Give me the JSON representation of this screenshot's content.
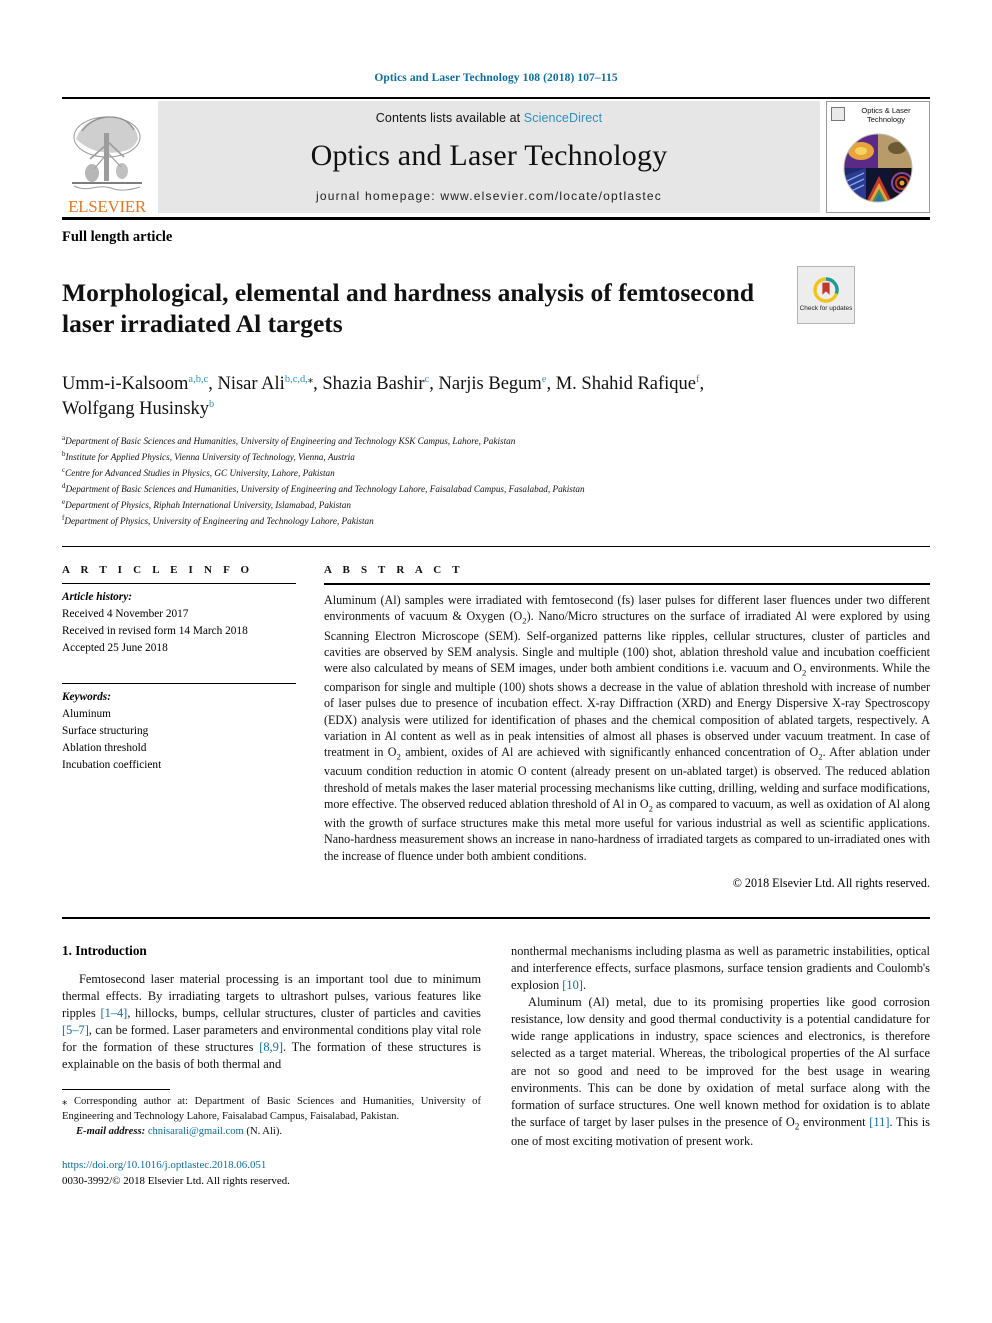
{
  "running_head": "Optics and Laser Technology 108 (2018) 107–115",
  "masthead": {
    "contents_prefix": "Contents lists available at ",
    "sciencedirect": "ScienceDirect",
    "journal_name": "Optics and Laser Technology",
    "homepage": "journal homepage: www.elsevier.com/locate/optlastec",
    "publisher": "ELSEVIER",
    "cover_title": "Optics & Laser Technology"
  },
  "article": {
    "type": "Full length article",
    "title": "Morphological, elemental and hardness analysis of femtosecond laser irradiated Al targets",
    "crossmark_label": "Check for updates"
  },
  "authors": {
    "line1_parts": [
      {
        "name": "Umm-i-Kalsoom",
        "sup": "a,b,c"
      },
      {
        "name": "Nisar Ali",
        "sup": "b,c,d,"
      },
      {
        "name": "Shazia Bashir",
        "sup": "c"
      },
      {
        "name": "Narjis Begum",
        "sup": "e"
      },
      {
        "name": "M. Shahid Rafique",
        "sup": "f"
      },
      {
        "name": "Wolfgang Husinsky",
        "sup": "b"
      }
    ]
  },
  "affiliations": [
    {
      "mark": "a",
      "text": "Department of Basic Sciences and Humanities, University of Engineering and Technology KSK Campus, Lahore, Pakistan"
    },
    {
      "mark": "b",
      "text": "Institute for Applied Physics, Vienna University of Technology, Vienna, Austria"
    },
    {
      "mark": "c",
      "text": "Centre for Advanced Studies in Physics, GC University, Lahore, Pakistan"
    },
    {
      "mark": "d",
      "text": "Department of Basic Sciences and Humanities, University of Engineering and Technology Lahore, Faisalabad Campus, Fasalabad, Pakistan"
    },
    {
      "mark": "e",
      "text": "Department of Physics, Riphah International University, Islamabad, Pakistan"
    },
    {
      "mark": "f",
      "text": "Department of Physics, University of Engineering and Technology Lahore, Pakistan"
    }
  ],
  "article_info": {
    "heading": "A R T I C L E   I N F O",
    "history_label": "Article history:",
    "history": [
      "Received 4 November 2017",
      "Received in revised form 14 March 2018",
      "Accepted 25 June 2018"
    ],
    "keywords_label": "Keywords:",
    "keywords": [
      "Aluminum",
      "Surface structuring",
      "Ablation threshold",
      "Incubation coefficient"
    ]
  },
  "abstract": {
    "heading": "A B S T R A C T",
    "paragraph_html": "Aluminum (Al) samples were irradiated with femtosecond (fs) laser pulses for different laser fluences under two different environments of vacuum &amp; Oxygen (O<sub>2</sub>). Nano/Micro structures on the surface of irradiated Al were explored by using Scanning Electron Microscope (SEM). Self-organized patterns like ripples, cellular structures, cluster of particles and cavities are observed by SEM analysis. Single and multiple (100) shot, ablation threshold value and incubation coefficient were also calculated by means of SEM images, under both ambient conditions i.e. vacuum and O<sub>2</sub> environments. While the comparison for single and multiple (100) shots shows a decrease in the value of ablation threshold with increase of number of laser pulses due to presence of incubation effect. X-ray Diffraction (XRD) and Energy Dispersive X-ray Spectroscopy (EDX) analysis were utilized for identification of phases and the chemical composition of ablated targets, respectively. A variation in Al content as well as in peak intensities of almost all phases is observed under vacuum treatment. In case of treatment in O<sub>2</sub> ambient, oxides of Al are achieved with significantly enhanced concentration of O<sub>2</sub>. After ablation under vacuum condition reduction in atomic O content (already present on un-ablated target) is observed. The reduced ablation threshold of metals makes the laser material processing mechanisms like cutting, drilling, welding and surface modifications, more effective. The observed reduced ablation threshold of Al in O<sub>2</sub> as compared to vacuum, as well as oxidation of Al along with the growth of surface structures make this metal more useful for various industrial as well as scientific applications. Nano-hardness measurement shows an increase in nano-hardness of irradiated targets as compared to un-irradiated ones with the increase of fluence under both ambient conditions.",
    "copyright": "© 2018 Elsevier Ltd. All rights reserved."
  },
  "body": {
    "section_heading": "1. Introduction",
    "left_paragraph_html": "Femtosecond laser material processing is an important tool due to minimum thermal effects. By irradiating targets to ultrashort pulses, various features like ripples <span class=\"ref\">[1–4]</span>, hillocks, bumps, cellular structures, cluster of particles and cavities <span class=\"ref\">[5–7]</span>, can be formed. Laser parameters and environmental conditions play vital role for the formation of these structures <span class=\"ref\">[8,9]</span>. The formation of these structures is explainable on the basis of both thermal and",
    "right_paragraph1_html": "nonthermal mechanisms including plasma as well as parametric instabilities, optical and interference effects, surface plasmons, surface tension gradients and Coulomb's explosion <span class=\"ref\">[10]</span>.",
    "right_paragraph2_html": "Aluminum (Al) metal, due to its promising properties like good corrosion resistance, low density and good thermal conductivity is a potential candidature for wide range applications in industry, space sciences and electronics, is therefore selected as a target material. Whereas, the tribological properties of the Al surface are not so good and need to be improved for the best usage in wearing environments. This can be done by oxidation of metal surface along with the formation of surface structures. One well known method for oxidation is to ablate the surface of target by laser pulses in the presence of O<sub>2</sub> environment <span class=\"ref\">[11]</span>. This is one of most exciting motivation of present work."
  },
  "footer": {
    "corresponding_html": "<span class=\"star\">⁎</span> Corresponding author at: Department of Basic Sciences and Humanities, University of Engineering and Technology Lahore, Faisalabad Campus, Faisalabad, Pakistan.",
    "email_label": "E-mail address:",
    "email": "chnisarali@gmail.com",
    "email_owner": "(N. Ali).",
    "doi": "https://doi.org/10.1016/j.optlastec.2018.06.051",
    "issn_line": "0030-3992/© 2018 Elsevier Ltd. All rights reserved."
  },
  "colors": {
    "link": "#0b6e9e",
    "sciencedirect": "#2f8fc4",
    "elsevier_orange": "#e87722",
    "masthead_bg": "#e6e6e6"
  }
}
